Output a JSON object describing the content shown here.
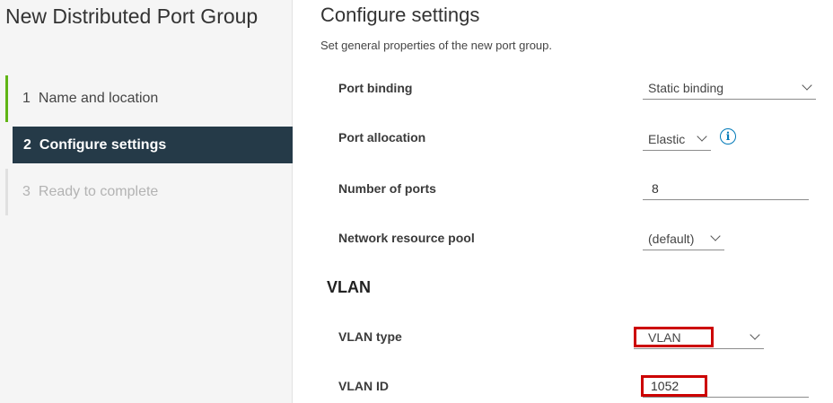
{
  "wizard": {
    "title": "New Distributed Port Group",
    "steps": [
      {
        "number": "1",
        "label": "Name and location",
        "state": "completed"
      },
      {
        "number": "2",
        "label": "Configure settings",
        "state": "current"
      },
      {
        "number": "3",
        "label": "Ready to complete",
        "state": "disabled"
      }
    ]
  },
  "page": {
    "title": "Configure settings",
    "subtitle": "Set general properties of the new port group."
  },
  "fields": {
    "port_binding": {
      "label": "Port binding",
      "value": "Static binding"
    },
    "port_allocation": {
      "label": "Port allocation",
      "value": "Elastic",
      "info_icon": "info-circle-icon"
    },
    "number_of_ports": {
      "label": "Number of ports",
      "value": "8"
    },
    "network_resource_pool": {
      "label": "Network resource pool",
      "value": "(default)"
    }
  },
  "vlan": {
    "section_title": "VLAN",
    "type": {
      "label": "VLAN type",
      "value": "VLAN"
    },
    "id": {
      "label": "VLAN ID",
      "value": "1052"
    }
  },
  "colors": {
    "current_step_bg": "#253a48",
    "completed_step_bar": "#60b515",
    "info_icon": "#0079b8",
    "highlight_box": "#cc0000"
  }
}
